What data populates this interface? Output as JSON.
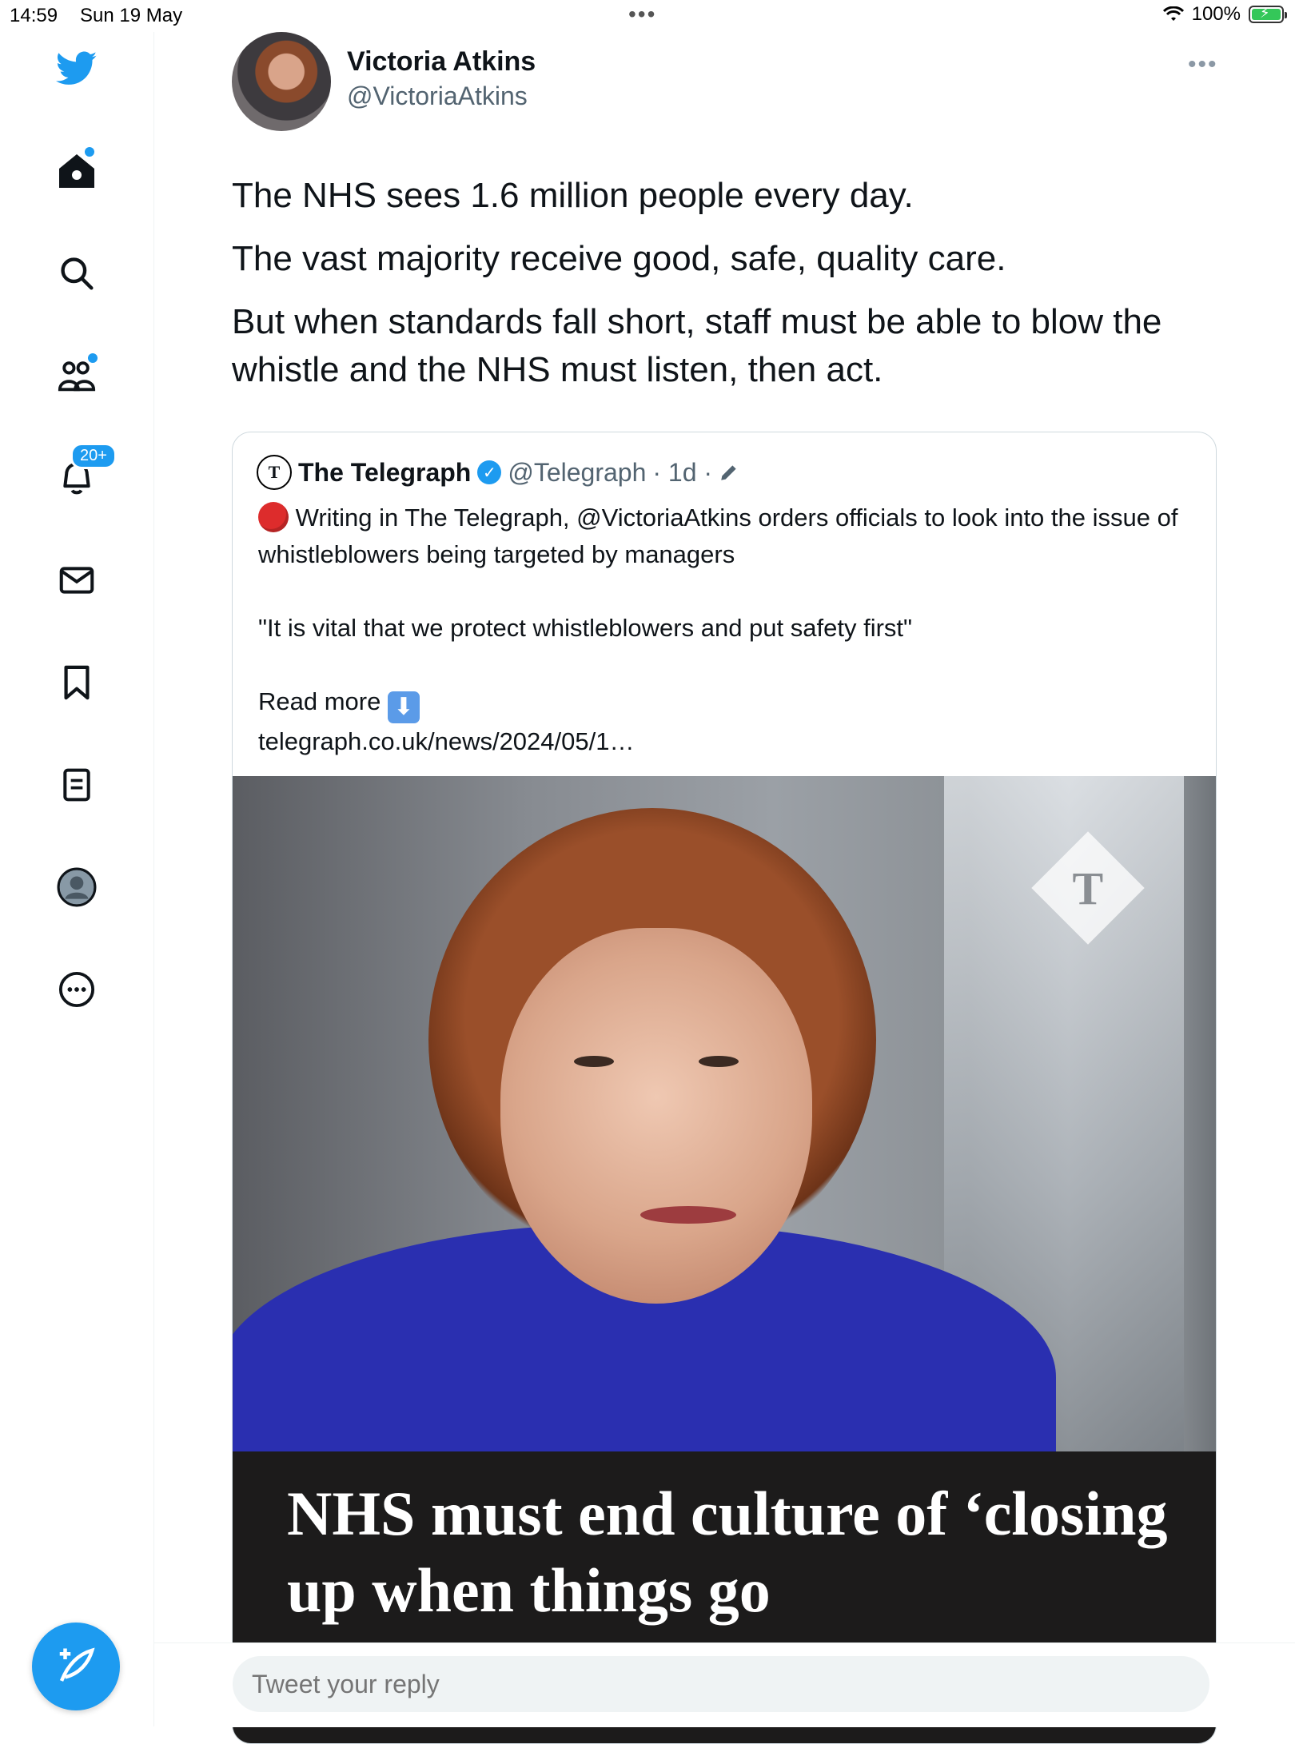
{
  "status_bar": {
    "time": "14:59",
    "date": "Sun 19 May",
    "battery": "100%"
  },
  "sidebar": {
    "notification_badge": "20+",
    "items": [
      {
        "name": "twitter-logo-icon"
      },
      {
        "name": "home-icon"
      },
      {
        "name": "search-icon"
      },
      {
        "name": "communities-icon"
      },
      {
        "name": "notifications-icon"
      },
      {
        "name": "messages-icon"
      },
      {
        "name": "bookmarks-icon"
      },
      {
        "name": "lists-icon"
      },
      {
        "name": "profile-icon"
      },
      {
        "name": "more-icon"
      }
    ],
    "accent_color": "#1d9bf0"
  },
  "tweet": {
    "author_name": "Victoria Atkins",
    "author_handle": "@VictoriaAtkins",
    "text": [
      "The NHS sees 1.6 million people every day.",
      "The vast majority receive good, safe, quality care.",
      "But when standards fall short, staff must be able to blow the whistle and the NHS must listen, then act."
    ]
  },
  "quoted_tweet": {
    "author_name": "The Telegraph",
    "author_handle": "@Telegraph",
    "time": "· 1d ·",
    "line1": "Writing in The Telegraph, @VictoriaAtkins orders officials to look into the issue of whistleblowers being targeted by managers",
    "quote": "\"It is vital that we protect whistleblowers and put safety first\"",
    "read_more": "Read more",
    "link": "telegraph.co.uk/news/2024/05/1…",
    "headline": "NHS must end culture of ‘closing up when things go"
  },
  "reply": {
    "placeholder": "Tweet your reply"
  }
}
